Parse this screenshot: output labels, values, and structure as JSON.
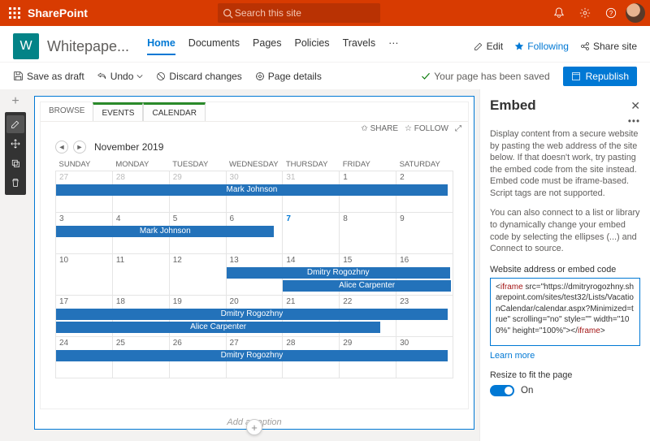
{
  "suite": {
    "product": "SharePoint",
    "search_placeholder": "Search this site"
  },
  "site": {
    "logo_letter": "W",
    "name": "Whitepape...",
    "nav": {
      "home": "Home",
      "documents": "Documents",
      "pages": "Pages",
      "policies": "Policies",
      "travels": "Travels",
      "more": "···"
    },
    "header_cmds": {
      "edit": "Edit",
      "following": "Following",
      "share": "Share site"
    }
  },
  "cmdbar": {
    "save_draft": "Save as draft",
    "undo": "Undo",
    "discard": "Discard changes",
    "page_details": "Page details",
    "saved_status": "Your page has been saved",
    "republish": "Republish"
  },
  "calendar": {
    "tabs": {
      "browse": "BROWSE",
      "events": "EVENTS",
      "calendar": "CALENDAR"
    },
    "toolbar": {
      "share": "SHARE",
      "follow": "FOLLOW"
    },
    "month_label": "November 2019",
    "dow": {
      "sun": "SUNDAY",
      "mon": "MONDAY",
      "tue": "TUESDAY",
      "wed": "WEDNESDAY",
      "thu": "THURSDAY",
      "fri": "FRIDAY",
      "sat": "SATURDAY"
    },
    "today_day": 7,
    "events": {
      "mark1": "Mark Johnson",
      "mark2": "Mark Johnson",
      "dmitry1": "Dmitry Rogozhny",
      "alice1": "Alice Carpenter",
      "dmitry2": "Dmitry Rogozhny",
      "alice2": "Alice Carpenter",
      "dmitry3": "Dmitry Rogozhny"
    }
  },
  "caption_placeholder": "Add a caption",
  "panel": {
    "title": "Embed",
    "desc1": "Display content from a secure website by pasting the web address of the site below. If that doesn't work, try pasting the embed code from the site instead. Embed code must be iframe-based. Script tags are not supported.",
    "desc2": "You can also connect to a list or library to dynamically change your embed code by selecting the ellipses (...) and Connect to source.",
    "field_label": "Website address or embed code",
    "embed_code_open": "<iframe",
    "embed_code_attrs": " src=\"https://dmitryrogozhny.sharepoint.com/sites/test32/Lists/VacationCalendar/calendar.aspx?Minimized=true\" scrolling=\"no\" style=\"\" width=\"100%\" height=\"100%\">",
    "embed_code_close": "</iframe>",
    "learn_more": "Learn more",
    "resize_label": "Resize to fit the page",
    "toggle_label": "On"
  }
}
